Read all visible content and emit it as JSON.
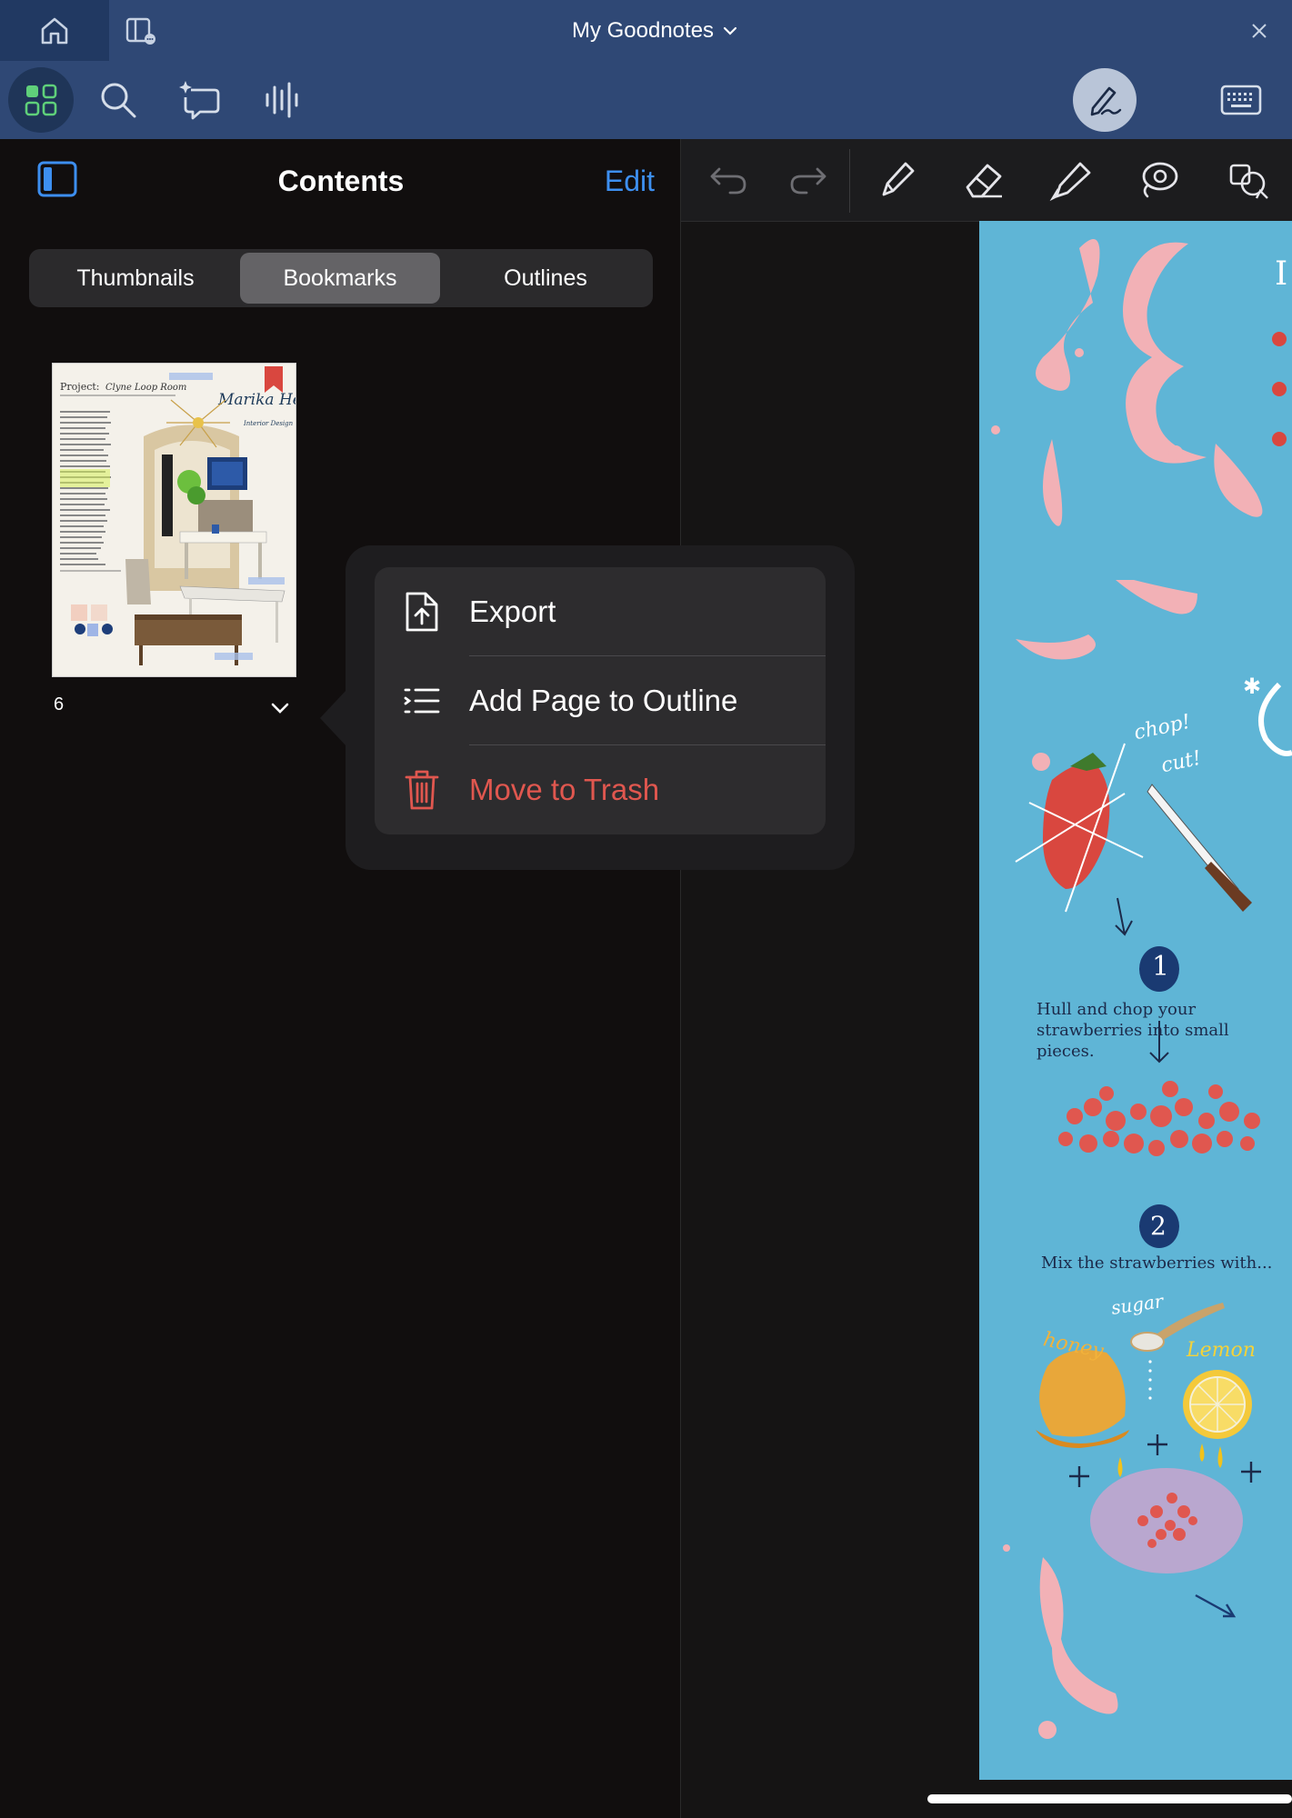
{
  "window": {
    "title": "My Goodnotes",
    "tabs": [
      {
        "name": "home-tab",
        "icon": "house-icon"
      },
      {
        "name": "sidebar-tab",
        "icon": "panel-icon"
      }
    ]
  },
  "toolbar": {
    "icons": [
      "grid-icon",
      "search-icon",
      "ai-sparkle-icon",
      "audio-waveform-icon",
      "pen-mode-icon",
      "keyboard-icon"
    ]
  },
  "sidebar": {
    "title": "Contents",
    "edit_label": "Edit",
    "segments": [
      "Thumbnails",
      "Bookmarks",
      "Outlines"
    ],
    "selected_segment": "Bookmarks",
    "bookmarked_page": {
      "page_number": "6",
      "thumbnail_text": {
        "project_label": "Project:",
        "project_name": "Clyne Loop Room",
        "designer": "Marika Hermine",
        "designer_sub": "Interior Design"
      }
    }
  },
  "context_menu": {
    "items": [
      {
        "label": "Export",
        "icon": "export-document-icon",
        "destructive": false
      },
      {
        "label": "Add Page to Outline",
        "icon": "outline-list-icon",
        "destructive": false
      },
      {
        "label": "Move to Trash",
        "icon": "trash-icon",
        "destructive": true
      }
    ]
  },
  "document_toolbar": {
    "icons": [
      "undo-icon",
      "redo-icon",
      "pen-icon",
      "eraser-icon",
      "highlighter-icon",
      "lasso-icon",
      "shapes-icon"
    ]
  },
  "recipe_page": {
    "chop": "chop!",
    "cut": "cut!",
    "step1_number": "1",
    "step1_text": "Hull and chop your strawberries into small pieces.",
    "step2_number": "2",
    "step2_text": "Mix the strawberries with...",
    "sugar": "sugar",
    "honey": "honey",
    "lemon": "Lemon"
  },
  "colors": {
    "titlebar": "#2f4875",
    "accent_blue": "#3d8ff0",
    "destructive_red": "#e0574f",
    "page_background": "#5fb5d6",
    "bookmark_red": "#d9473f"
  }
}
